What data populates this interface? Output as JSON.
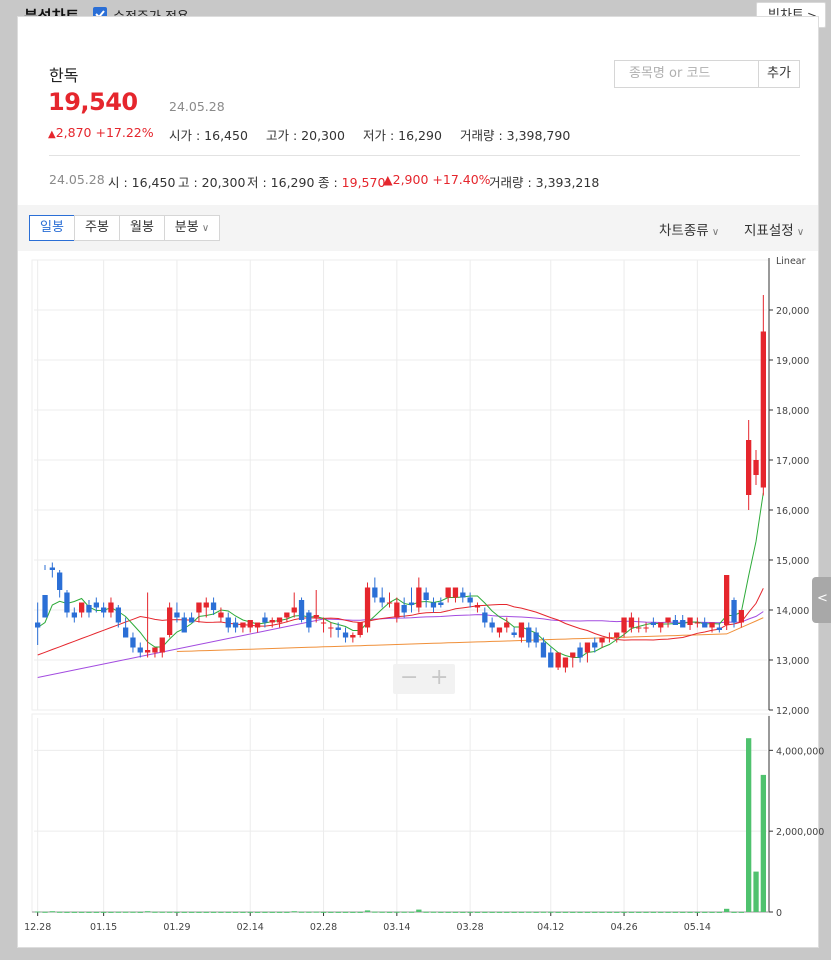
{
  "header": {
    "title": "분석차트",
    "adjusted_price_label": "수정주가 적용",
    "adjusted_price_checked": true,
    "big_chart_label": "빅차트"
  },
  "stock": {
    "name": "한독",
    "price": "19,540",
    "date": "24.05.28",
    "change": "2,870",
    "change_pct": "+17.22%",
    "open_label": "시가 :",
    "open": "16,450",
    "high_label": "고가 :",
    "high": "20,300",
    "low_label": "저가 :",
    "low": "16,290",
    "volume_label": "거래량 :",
    "volume": "3,398,790"
  },
  "search": {
    "placeholder": "종목명 or 코드",
    "add_label": "추가"
  },
  "day_info": {
    "date": "24.05.28",
    "open_label": "시 :",
    "open": "16,450",
    "high_label": "고 :",
    "high": "20,300",
    "low_label": "저 :",
    "low": "16,290",
    "close_label": "종 :",
    "close": "19,570",
    "change": "2,900",
    "change_pct": "+17.40%",
    "volume_label": "거래량 :",
    "volume": "3,393,218"
  },
  "tabs": [
    {
      "label": "일봉",
      "active": true
    },
    {
      "label": "주봉",
      "active": false
    },
    {
      "label": "월봉",
      "active": false
    },
    {
      "label": "분봉",
      "active": false
    }
  ],
  "right_menu": {
    "chart_type": "차트종류",
    "indicator": "지표설정"
  },
  "colors": {
    "up": "#e5262d",
    "down": "#2b6fd6",
    "ma5": "#2eab3a",
    "ma20": "#e5262d",
    "ma60": "#a34ce0",
    "ma120": "#f0903a",
    "volume": "#4fc26e"
  },
  "chart_data": {
    "type": "candlestick",
    "scale_label": "Linear",
    "y_ticks": [
      "20,000",
      "19,000",
      "18,000",
      "17,000",
      "16,000",
      "15,000",
      "14,000",
      "13,000",
      "12,000"
    ],
    "y_min": 12000,
    "y_max": 21000,
    "volume_ticks": [
      "4,000,000",
      "2,000,000",
      "0"
    ],
    "volume_max": 4800000,
    "x_labels": [
      "12.28",
      "01.15",
      "01.29",
      "02.14",
      "02.28",
      "03.14",
      "03.28",
      "04.12",
      "04.26",
      "05.14"
    ],
    "x_label_index": [
      0,
      9,
      19,
      29,
      39,
      49,
      59,
      70,
      80,
      90
    ],
    "candles": [
      [
        13750,
        14150,
        13650,
        13300
      ],
      [
        14300,
        14800,
        13850,
        14900
      ],
      [
        14850,
        14950,
        14800,
        14650
      ],
      [
        14750,
        14800,
        14400,
        14250
      ],
      [
        14350,
        14400,
        13950,
        13850
      ],
      [
        13950,
        14050,
        13850,
        13750
      ],
      [
        13950,
        14050,
        14150,
        13850
      ],
      [
        14100,
        14200,
        13950,
        13850
      ],
      [
        14150,
        14250,
        14050,
        13950
      ],
      [
        14050,
        14150,
        13950,
        13850
      ],
      [
        13950,
        14250,
        14150,
        13850
      ],
      [
        14050,
        14100,
        13750,
        13650
      ],
      [
        13650,
        13850,
        13450,
        13450
      ],
      [
        13450,
        13550,
        13250,
        13150
      ],
      [
        13250,
        13350,
        13150,
        13050
      ],
      [
        13150,
        14350,
        13200,
        13050
      ],
      [
        13150,
        13150,
        13250,
        13050
      ],
      [
        13150,
        13450,
        13450,
        13050
      ],
      [
        13500,
        14150,
        14050,
        13450
      ],
      [
        13950,
        14150,
        13850,
        13750
      ],
      [
        13850,
        13950,
        13550,
        13550
      ],
      [
        13850,
        13950,
        13750,
        13750
      ],
      [
        13950,
        14050,
        14150,
        13750
      ],
      [
        14050,
        14250,
        14150,
        13850
      ],
      [
        14150,
        14250,
        14000,
        13900
      ],
      [
        13850,
        14050,
        13950,
        13750
      ],
      [
        13850,
        13950,
        13650,
        13550
      ],
      [
        13750,
        13850,
        13650,
        13550
      ],
      [
        13650,
        13750,
        13750,
        13550
      ],
      [
        13650,
        13750,
        13800,
        13550
      ],
      [
        13650,
        13750,
        13750,
        13550
      ],
      [
        13850,
        13950,
        13750,
        13650
      ],
      [
        13750,
        13850,
        13800,
        13650
      ],
      [
        13750,
        13850,
        13850,
        13650
      ],
      [
        13850,
        13950,
        13950,
        13750
      ],
      [
        13950,
        14350,
        14050,
        13850
      ],
      [
        14200,
        14250,
        13800,
        13750
      ],
      [
        13950,
        14000,
        13650,
        13550
      ],
      [
        13850,
        14400,
        13900,
        13750
      ],
      [
        13750,
        13850,
        13750,
        13550
      ],
      [
        13650,
        13750,
        13650,
        13450
      ],
      [
        13650,
        13750,
        13600,
        13450
      ],
      [
        13550,
        13650,
        13450,
        13350
      ],
      [
        13450,
        13550,
        13500,
        13350
      ],
      [
        13500,
        13750,
        13750,
        13450
      ],
      [
        13650,
        14550,
        14450,
        13550
      ],
      [
        14450,
        14650,
        14250,
        14150
      ],
      [
        14250,
        14450,
        14150,
        14050
      ],
      [
        14150,
        14350,
        14150,
        14050
      ],
      [
        13850,
        14250,
        14150,
        13750
      ],
      [
        14100,
        14250,
        13950,
        13850
      ],
      [
        14150,
        14450,
        14100,
        13950
      ],
      [
        14050,
        14650,
        14450,
        13950
      ],
      [
        14350,
        14450,
        14200,
        14050
      ],
      [
        14150,
        14250,
        14050,
        13950
      ],
      [
        14150,
        14250,
        14100,
        14050
      ],
      [
        14250,
        14350,
        14450,
        14150
      ],
      [
        14250,
        14350,
        14450,
        14150
      ],
      [
        14350,
        14450,
        14250,
        14150
      ],
      [
        14250,
        14350,
        14150,
        14050
      ],
      [
        14050,
        14150,
        14100,
        13950
      ],
      [
        13950,
        14050,
        13750,
        13650
      ],
      [
        13750,
        13850,
        13650,
        13550
      ],
      [
        13550,
        13650,
        13650,
        13450
      ],
      [
        13650,
        13850,
        13750,
        13550
      ],
      [
        13550,
        13650,
        13500,
        13450
      ],
      [
        13450,
        13650,
        13750,
        13350
      ],
      [
        13650,
        13750,
        13350,
        13250
      ],
      [
        13550,
        13650,
        13350,
        13250
      ],
      [
        13350,
        13450,
        13050,
        13050
      ],
      [
        13150,
        13250,
        12850,
        12850
      ],
      [
        12850,
        12950,
        13150,
        12800
      ],
      [
        12850,
        12950,
        13050,
        12750
      ],
      [
        13050,
        13150,
        13150,
        12850
      ],
      [
        13250,
        13350,
        13050,
        12950
      ],
      [
        13150,
        13250,
        13350,
        12950
      ],
      [
        13350,
        13450,
        13250,
        13150
      ],
      [
        13350,
        13450,
        13450,
        13250
      ],
      [
        13450,
        13550,
        13450,
        13350
      ],
      [
        13450,
        13550,
        13550,
        13350
      ],
      [
        13550,
        13850,
        13850,
        13450
      ],
      [
        13650,
        13950,
        13850,
        13550
      ],
      [
        13650,
        13850,
        13650,
        13550
      ],
      [
        13650,
        13750,
        13650,
        13550
      ],
      [
        13750,
        13850,
        13700,
        13650
      ],
      [
        13650,
        13750,
        13750,
        13550
      ],
      [
        13750,
        13850,
        13850,
        13650
      ],
      [
        13800,
        13900,
        13700,
        13700
      ],
      [
        13800,
        13900,
        13650,
        13650
      ],
      [
        13700,
        13800,
        13850,
        13600
      ],
      [
        13750,
        13850,
        13750,
        13650
      ],
      [
        13750,
        13850,
        13650,
        13650
      ],
      [
        13650,
        13750,
        13750,
        13550
      ],
      [
        13650,
        13750,
        13600,
        13550
      ],
      [
        13700,
        13800,
        14700,
        13600
      ],
      [
        14200,
        14250,
        13750,
        13650
      ],
      [
        13750,
        13850,
        14000,
        13650
      ],
      [
        16300,
        17800,
        17400,
        16000
      ],
      [
        16700,
        17200,
        17000,
        16500
      ],
      [
        16450,
        20300,
        19570,
        16290
      ]
    ],
    "volume": [
      12000,
      5000,
      20000,
      4000,
      2000,
      3000,
      2000,
      2000,
      2000,
      2000,
      3000,
      4000,
      4000,
      5000,
      3000,
      20000,
      4000,
      5000,
      6000,
      3000,
      2000,
      2000,
      3000,
      3000,
      2000,
      2000,
      2000,
      2000,
      2000,
      2000,
      2000,
      2000,
      2000,
      2000,
      3000,
      20000,
      5000,
      4000,
      8000,
      3000,
      2000,
      2000,
      2000,
      2000,
      3000,
      40000,
      8000,
      4000,
      3000,
      5000,
      4000,
      5000,
      60000,
      6000,
      4000,
      3000,
      3000,
      3000,
      3000,
      2000,
      2000,
      3000,
      2000,
      2000,
      2000,
      2000,
      3000,
      4000,
      3000,
      5000,
      4000,
      3000,
      3000,
      2000,
      2000,
      2000,
      2000,
      2000,
      2000,
      2000,
      3000,
      2000,
      2000,
      2000,
      2000,
      2000,
      2000,
      2000,
      2000,
      2000,
      2000,
      2000,
      2000,
      2000,
      80000,
      3000,
      2000,
      4300000,
      1000000,
      3393218
    ]
  }
}
